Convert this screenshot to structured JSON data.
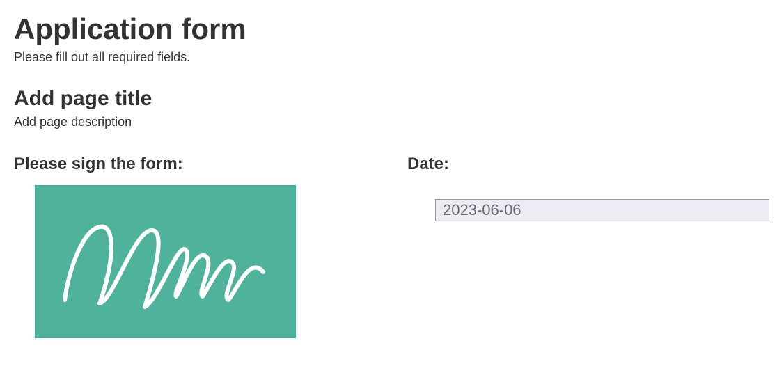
{
  "form": {
    "title": "Application form",
    "subtitle": "Please fill out all required fields."
  },
  "page": {
    "title": "Add page title",
    "description": "Add page description"
  },
  "fields": {
    "signature": {
      "label": "Please sign the form:",
      "bg_color": "#4fb29a",
      "stroke_color": "#ffffff"
    },
    "date": {
      "label": "Date:",
      "value": "2023-06-06"
    }
  }
}
